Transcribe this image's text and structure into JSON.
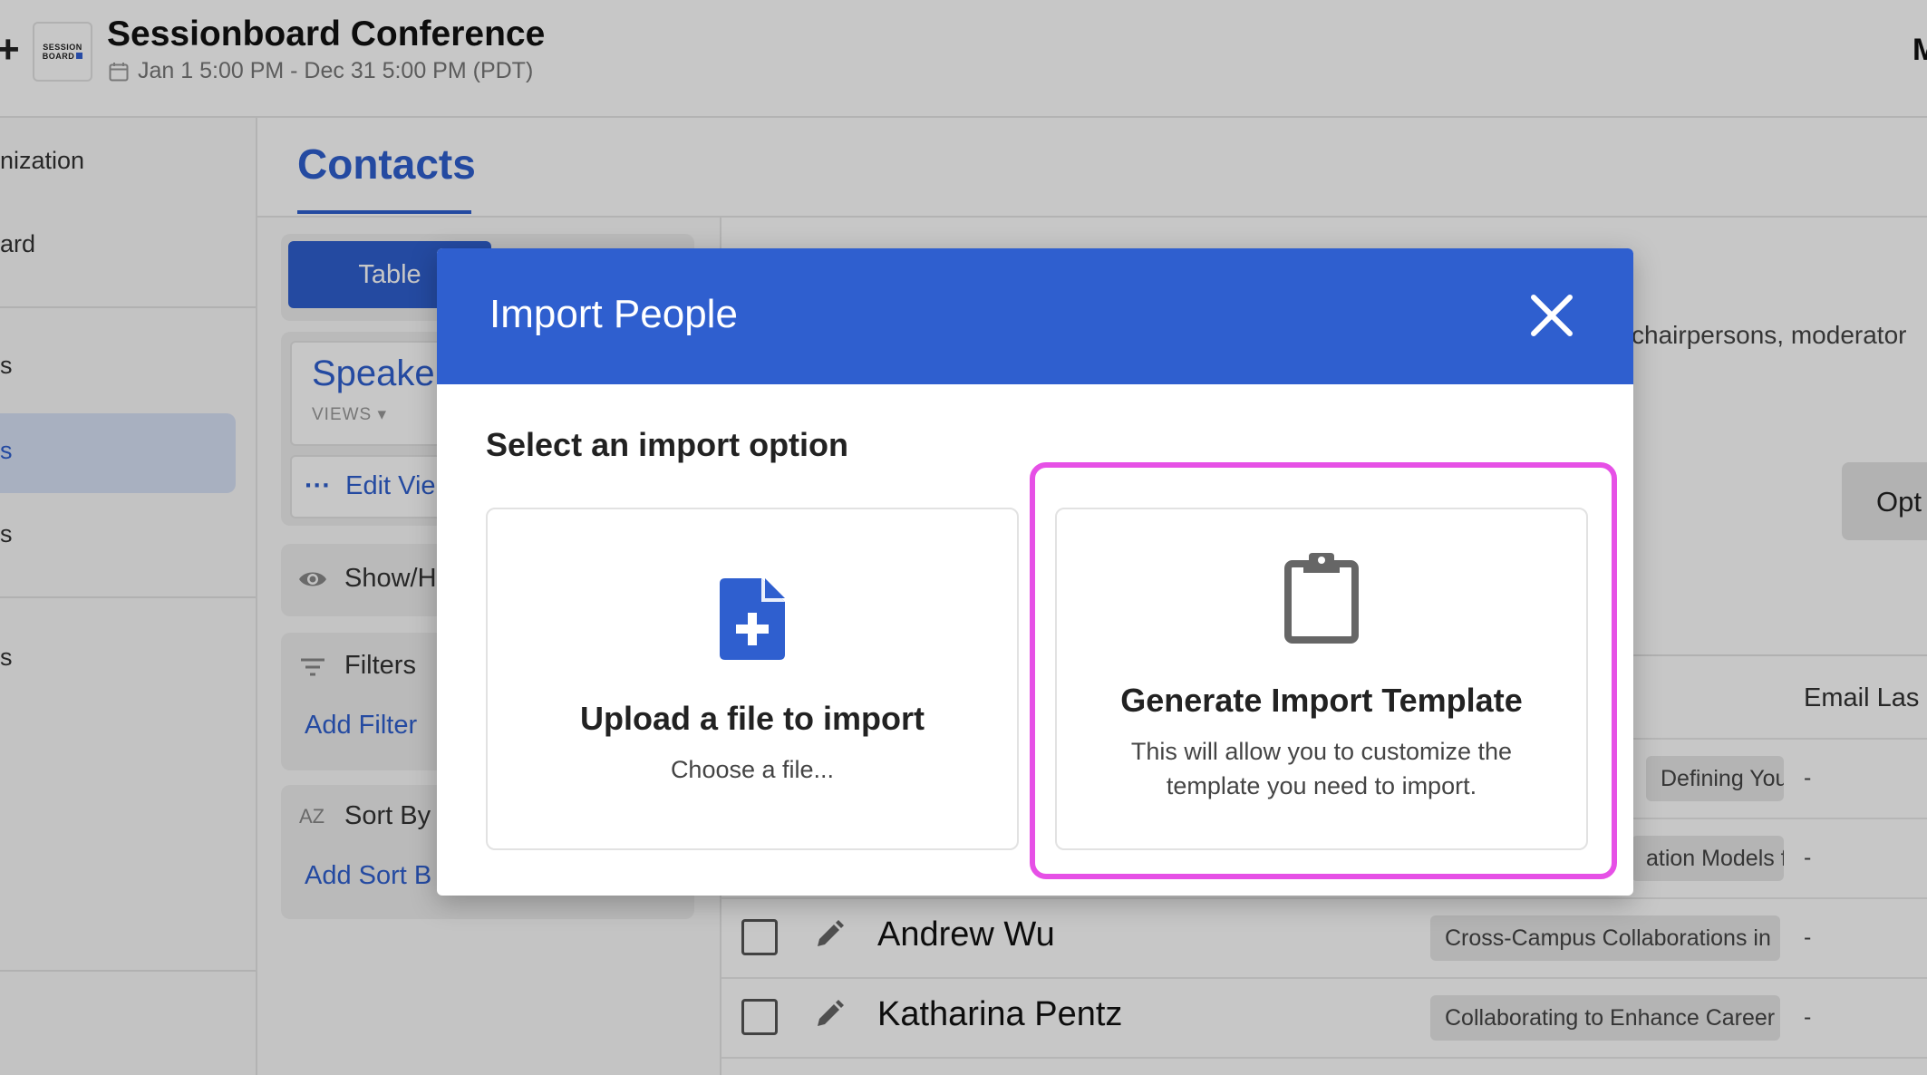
{
  "colors": {
    "accent": "#2f5fcf",
    "highlight": "#e650e6"
  },
  "header": {
    "logo_line1": "SESSION",
    "logo_line2": "BOARD",
    "event_title": "Sessionboard Conference",
    "event_dates": "Jan 1 5:00 PM - Dec 31 5:00 PM (PDT)",
    "right_letter": "M"
  },
  "sidebar": {
    "items": [
      {
        "label": "nization"
      },
      {
        "label": "ard"
      },
      {
        "label": "s"
      },
      {
        "label": "s"
      },
      {
        "label": "s"
      },
      {
        "label": "s"
      }
    ]
  },
  "page": {
    "title": "Contacts"
  },
  "left_panel": {
    "table_label": "Table",
    "view_name": "Speaker",
    "views_label": "VIEWS",
    "edit_view": "Edit Vie",
    "show_hide": "Show/H",
    "filters": "Filters",
    "add_filter": "Add Filter",
    "sort_by": "Sort By",
    "add_sort": "Add Sort B"
  },
  "main": {
    "description": "chairpersons, moderator",
    "options_button": "Opt",
    "column_email": "Email Las",
    "rows": [
      {
        "name": "",
        "session": "Defining You",
        "email": "-"
      },
      {
        "name": "",
        "session": "ation Models fo",
        "email": "-"
      },
      {
        "name": "Andrew Wu",
        "session": "Cross-Campus Collaborations in",
        "email": "-"
      },
      {
        "name": "Katharina Pentz",
        "session": "Collaborating to Enhance Career",
        "email": "-"
      }
    ]
  },
  "modal": {
    "title": "Import People",
    "subtitle": "Select an import option",
    "options": [
      {
        "title": "Upload a file to import",
        "description": "Choose a file...",
        "icon": "file-plus-icon"
      },
      {
        "title": "Generate Import Template",
        "description_line1": "This will allow you to customize the",
        "description_line2": "template you need to import.",
        "icon": "clipboard-icon"
      }
    ]
  }
}
